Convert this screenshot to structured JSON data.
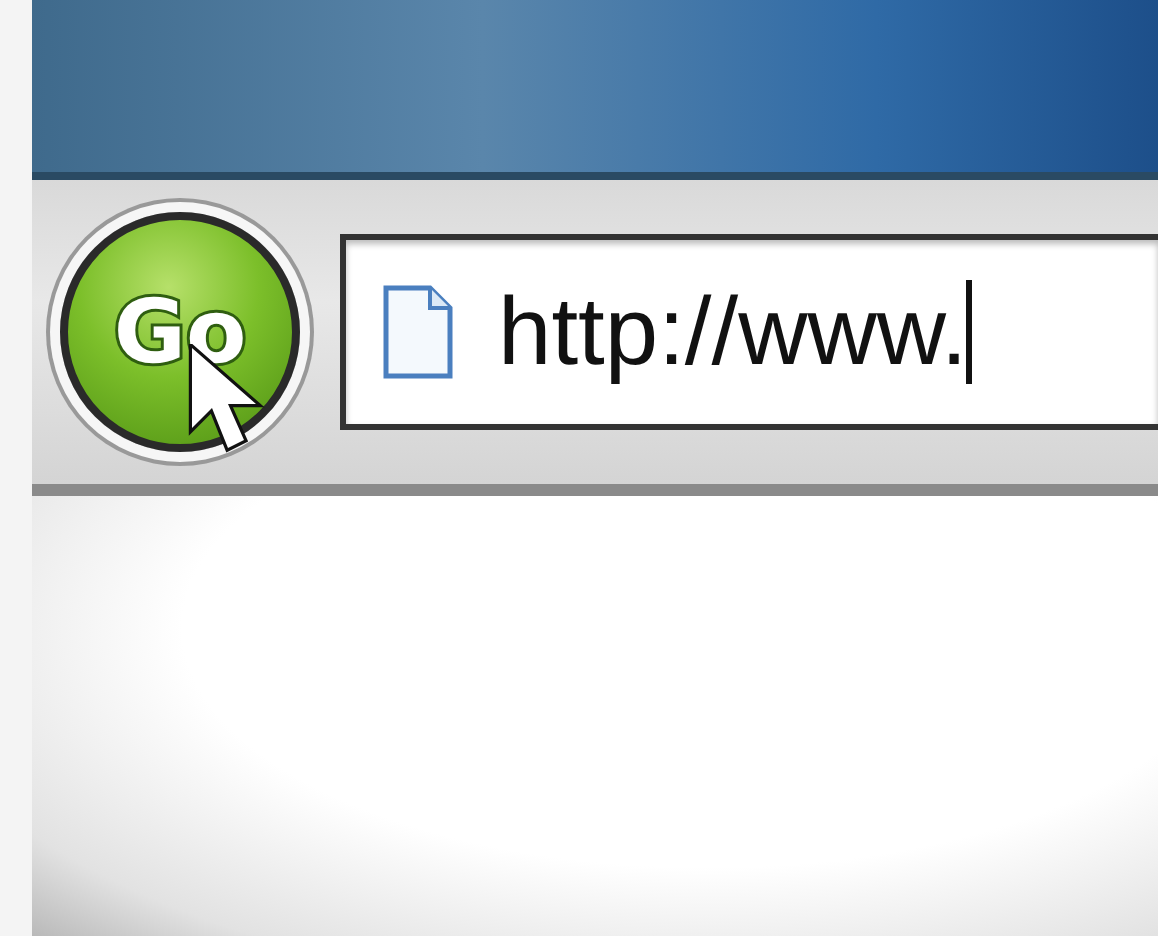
{
  "toolbar": {
    "go_button": {
      "label": "Go"
    },
    "address_bar": {
      "value": "http://www."
    }
  }
}
